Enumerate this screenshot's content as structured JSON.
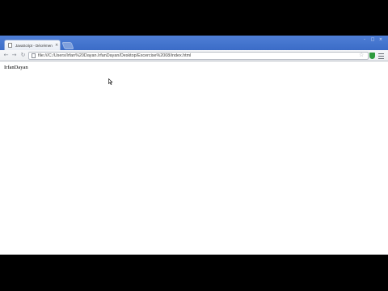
{
  "browser": {
    "tab": {
      "title": "JavaScript - Décrémentation",
      "close_glyph": "×"
    },
    "window_controls": {
      "minimize": "-",
      "maximize": "□",
      "close": "×"
    },
    "toolbar": {
      "back_glyph": "←",
      "forward_glyph": "→",
      "reload_glyph": "↻",
      "url": "file:///C:/Users/Irfan%20Dayan.IrfanDayan/Desktop/Excercise%2008/index.html",
      "bookmark_glyph": "☆"
    }
  },
  "page": {
    "text": "IrfanDayan"
  }
}
